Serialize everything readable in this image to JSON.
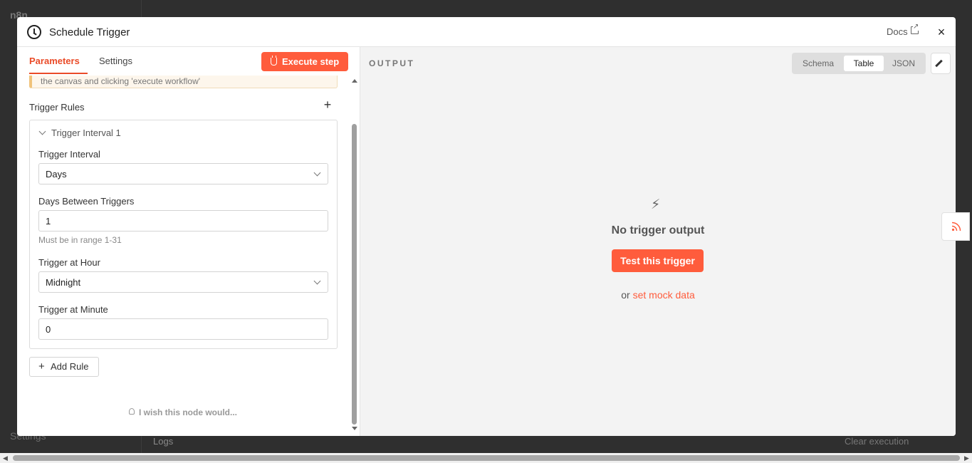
{
  "background": {
    "app_name": "n8n",
    "settings_label": "Settings",
    "logs_label": "Logs",
    "clear_execution_label": "Clear execution"
  },
  "modal": {
    "title": "Schedule Trigger",
    "docs_label": "Docs",
    "close_glyph": "×"
  },
  "left": {
    "tabs": [
      {
        "label": "Parameters",
        "active": true
      },
      {
        "label": "Settings",
        "active": false
      }
    ],
    "execute_label": "Execute step",
    "notice_text": "the canvas and clicking 'execute workflow'",
    "trigger_rules_label": "Trigger Rules",
    "add_glyph": "+",
    "rule": {
      "header": "Trigger Interval 1",
      "fields": {
        "interval_label": "Trigger Interval",
        "interval_value": "Days",
        "days_label": "Days Between Triggers",
        "days_value": "1",
        "days_hint": "Must be in range 1-31",
        "hour_label": "Trigger at Hour",
        "hour_value": "Midnight",
        "minute_label": "Trigger at Minute",
        "minute_value": "0"
      }
    },
    "add_rule_label": "Add Rule",
    "wish_label": "I wish this node would..."
  },
  "right": {
    "output_label": "OUTPUT",
    "views": [
      {
        "label": "Schema",
        "active": false
      },
      {
        "label": "Table",
        "active": true
      },
      {
        "label": "JSON",
        "active": false
      }
    ],
    "empty_title": "No trigger output",
    "test_button": "Test this trigger",
    "or_text": "or",
    "mock_link": "set mock data"
  },
  "colors": {
    "accent": "#ff5c3c",
    "active_tab": "#ea4b28"
  },
  "icons": [
    "clock-icon",
    "external-link-icon",
    "close-icon",
    "flask-icon",
    "plus-icon",
    "chevron-down-icon",
    "bulb-icon",
    "bolt-icon",
    "pencil-icon",
    "rss-icon"
  ]
}
